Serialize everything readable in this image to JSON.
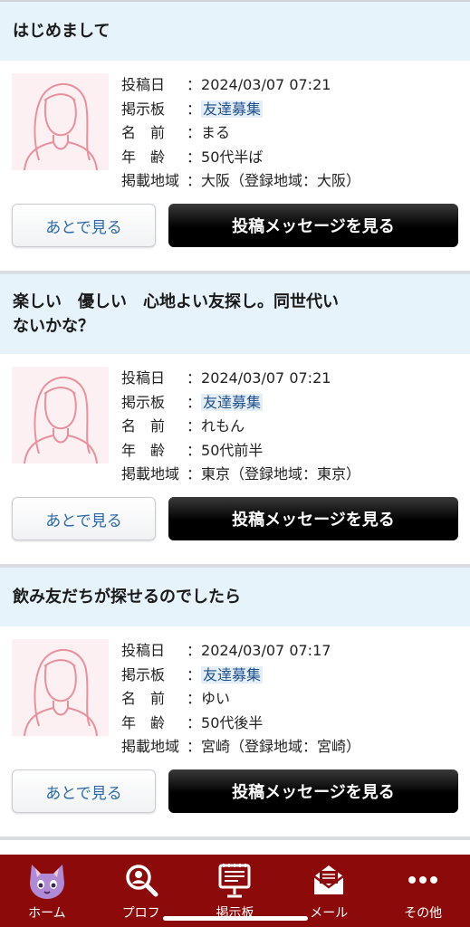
{
  "labels": {
    "posted_at": "投稿日",
    "board": "掲示板",
    "name": "名　前",
    "age": "年　齢",
    "region": "掲載地域",
    "separator": "："
  },
  "posts": [
    {
      "title": "はじめまして",
      "posted_at": "2024/03/07 07:21",
      "board": "友達募集",
      "name": "まる",
      "age": "50代半ば",
      "region": "大阪（登録地域：大阪）",
      "later_label": "あとで見る",
      "view_label": "投稿メッセージを見る"
    },
    {
      "title": "楽しい　優しい　心地よい友探し。同世代い\nないかな？",
      "posted_at": "2024/03/07 07:21",
      "board": "友達募集",
      "name": "れもん",
      "age": "50代前半",
      "region": "東京（登録地域：東京）",
      "later_label": "あとで見る",
      "view_label": "投稿メッセージを見る"
    },
    {
      "title": "飲み友だちが探せるのでしたら",
      "posted_at": "2024/03/07 07:17",
      "board": "友達募集",
      "name": "ゆい",
      "age": "50代後半",
      "region": "宮崎（登録地域：宮崎）",
      "later_label": "あとで見る",
      "view_label": "投稿メッセージを見る"
    }
  ],
  "tab_bar": {
    "items": [
      {
        "label": "ホーム",
        "icon": "cat-mascot-icon"
      },
      {
        "label": "プロフ",
        "icon": "search-icon"
      },
      {
        "label": "掲示板",
        "icon": "board-icon"
      },
      {
        "label": "メール",
        "icon": "mail-icon"
      },
      {
        "label": "その他",
        "icon": "more-icon"
      }
    ]
  },
  "colors": {
    "title_background": "#e6f3fb",
    "tab_bar": "#8c0a0a",
    "link": "#2a6aa8",
    "view_button": "#000000"
  }
}
